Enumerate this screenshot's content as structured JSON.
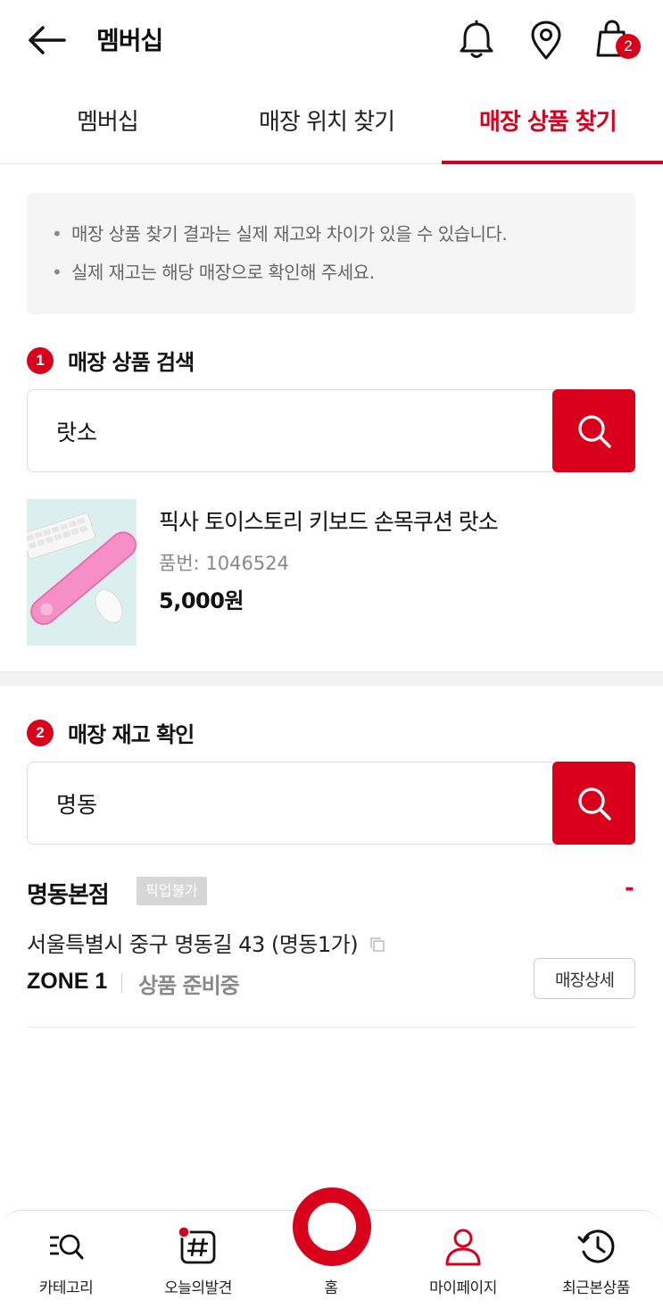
{
  "header": {
    "title": "멤버십",
    "cart_count": "2"
  },
  "tabs": [
    {
      "label": "멤버십"
    },
    {
      "label": "매장 위치 찾기"
    },
    {
      "label": "매장 상품 찾기"
    }
  ],
  "notice": {
    "lines": [
      "매장 상품 찾기 결과는 실제 재고와 차이가 있을 수 있습니다.",
      "실제 재고는 해당 매장으로 확인해 주세요."
    ],
    "bullet": "•"
  },
  "product_search": {
    "step": "1",
    "title": "매장 상품 검색",
    "query": "랏소"
  },
  "product": {
    "name": "픽사 토이스토리 키보드 손목쿠션 랏소",
    "code": "품번: 1046524",
    "price": "5,000원"
  },
  "stock_check": {
    "step": "2",
    "title": "매장 재고 확인",
    "query": "명동"
  },
  "store": {
    "name": "명동본점",
    "pickup_badge": "픽업불가",
    "stock_marker": "-",
    "address": "서울특별시 중구 명동길 43 (명동1가)",
    "zone": "ZONE 1",
    "zone_status": "상품 준비중",
    "detail_label": "매장상세"
  },
  "bottom_nav": [
    {
      "label": "카테고리",
      "icon": "category-search-icon"
    },
    {
      "label": "오늘의발견",
      "icon": "hashtag-icon"
    },
    {
      "label": "홈",
      "icon": "home-ring-icon"
    },
    {
      "label": "마이페이지",
      "icon": "person-icon"
    },
    {
      "label": "최근본상품",
      "icon": "history-icon"
    }
  ],
  "colors": {
    "accent": "#d9001b",
    "notice_bg": "#f5f5f5",
    "muted_text": "#888888"
  }
}
